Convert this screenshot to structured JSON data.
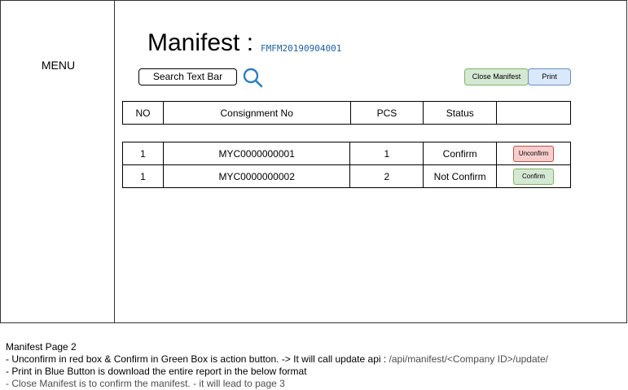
{
  "sidebar": {
    "menu_label": "MENU"
  },
  "header": {
    "title": "Manifest :",
    "manifest_id": "FMFM20190904001"
  },
  "search": {
    "label": "Search Text Bar",
    "icon": "search-icon"
  },
  "toolbar": {
    "close_manifest_label": "Close Manifest",
    "print_label": "Print"
  },
  "table": {
    "columns": [
      "NO",
      "Consignment No",
      "PCS",
      "Status",
      ""
    ],
    "rows": [
      {
        "no": "1",
        "consignment_no": "MYC0000000001",
        "pcs": "1",
        "status": "Confirm",
        "action": "Unconfirm"
      },
      {
        "no": "1",
        "consignment_no": "MYC0000000002",
        "pcs": "2",
        "status": "Not Confirm",
        "action": "Confirm"
      }
    ]
  },
  "notes": {
    "title": "Manifest Page 2",
    "line1_main": "- Unconfirm in red box & Confirm in Green Box is action button. -> It will call update api :",
    "line1_api": " /api/manifest/<Company ID>/update/",
    "line2": "- Print in Blue Button is download the entire report in the below format",
    "line3": "- Close Manifest is to confirm the manifest. - it will lead to page 3"
  },
  "colors": {
    "green_fill": "#d5e8d4",
    "green_border": "#82b366",
    "blue_fill": "#dae8fc",
    "blue_border": "#6c8ebf",
    "red_fill": "#f8cecc",
    "red_border": "#b85450",
    "id_text": "#1f5f9e",
    "search_icon": "#2a7fc1"
  }
}
